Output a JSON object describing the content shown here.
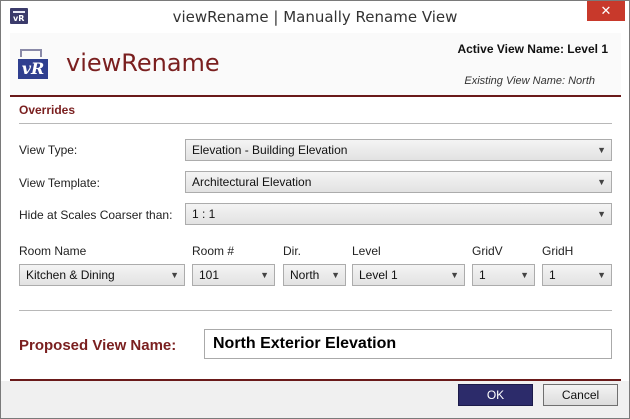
{
  "window": {
    "title": "viewRename | Manually Rename View",
    "close_glyph": "✕"
  },
  "header": {
    "logo_text": "vR",
    "brand": "viewRename",
    "active_view": "Active View Name:  Level 1",
    "existing_view": "Existing View Name: North"
  },
  "overrides": {
    "title": "Overrides",
    "view_type": {
      "label": "View Type:",
      "value": "Elevation - Building Elevation"
    },
    "view_template": {
      "label": "View Template:",
      "value": "Architectural Elevation"
    },
    "hide_scale": {
      "label": "Hide at Scales Coarser than:",
      "value": "1 : 1"
    }
  },
  "fields": {
    "room_name": {
      "label": "Room Name",
      "value": "Kitchen & Dining"
    },
    "room_number": {
      "label": "Room #",
      "value": "101"
    },
    "dir": {
      "label": "Dir.",
      "value": "North"
    },
    "level": {
      "label": "Level",
      "value": "Level 1"
    },
    "gridv": {
      "label": "GridV",
      "value": "1"
    },
    "gridh": {
      "label": "GridH",
      "value": "1"
    }
  },
  "proposed": {
    "label": "Proposed View Name:",
    "value": "North Exterior Elevation"
  },
  "buttons": {
    "ok": "OK",
    "cancel": "Cancel"
  },
  "icons": {
    "dropdown": "chevron-down-icon",
    "chevron_glyph": "⌄"
  },
  "colors": {
    "accent": "#7a1f1f",
    "primary_button": "#2c2b6a",
    "close": "#c8392b"
  }
}
